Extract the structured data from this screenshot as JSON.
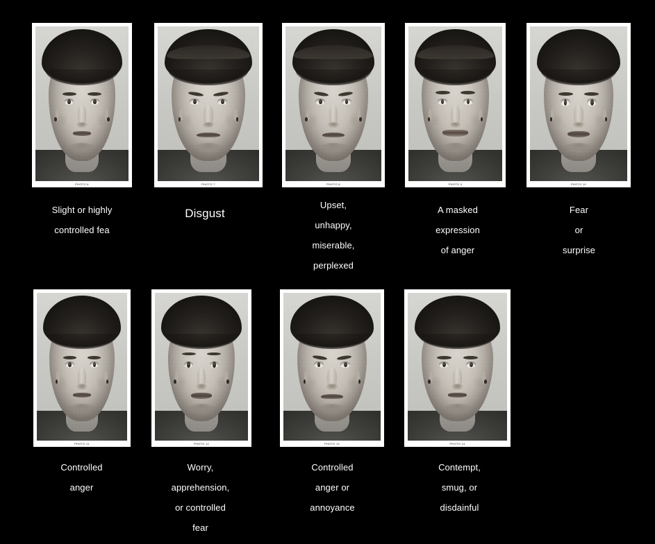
{
  "page": {
    "background_color": "#000000",
    "text_color": "#ffffff",
    "layout": "5 panels in top row, 4 panels in bottom row",
    "subject": "grayscale frontal portrait photographs of a woman with differing facial expressions"
  },
  "panels": [
    {
      "photo_label": "PHOTO 6",
      "caption_lines": [
        "Slight or highly",
        "controlled fea"
      ],
      "caption_style": "normal",
      "expression": "ex-tight"
    },
    {
      "photo_label": "PHOTO 7",
      "caption_lines": [
        "Disgust"
      ],
      "caption_style": "big",
      "expression": "ex-frown"
    },
    {
      "photo_label": "PHOTO 8",
      "caption_lines": [
        "Upset,",
        "unhappy,",
        "miserable,",
        "perplexed"
      ],
      "caption_style": "normal",
      "expression": "ex-frown"
    },
    {
      "photo_label": "PHOTO 9",
      "caption_lines": [
        "A masked",
        "expression",
        "of anger"
      ],
      "caption_style": "normal",
      "expression": "ex-smile"
    },
    {
      "photo_label": "PHOTO 10",
      "caption_lines": [
        "Fear",
        "or",
        "surprise"
      ],
      "caption_style": "normal",
      "expression": "ex-wide"
    },
    {
      "photo_label": "PHOTO 11",
      "caption_lines": [
        "Controlled",
        "anger"
      ],
      "caption_style": "normal",
      "expression": "ex-tight"
    },
    {
      "photo_label": "PHOTO 12",
      "caption_lines": [
        "Worry,",
        "apprehension,",
        "or controlled",
        "fear"
      ],
      "caption_style": "normal",
      "expression": "ex-raised"
    },
    {
      "photo_label": "PHOTO 13",
      "caption_lines": [
        "Controlled",
        "anger or",
        "annoyance"
      ],
      "caption_style": "normal",
      "expression": "ex-frown"
    },
    {
      "photo_label": "PHOTO 14",
      "caption_lines": [
        "Contempt,",
        "smug, or",
        "disdainful"
      ],
      "caption_style": "normal",
      "expression": "ex-tight"
    }
  ]
}
